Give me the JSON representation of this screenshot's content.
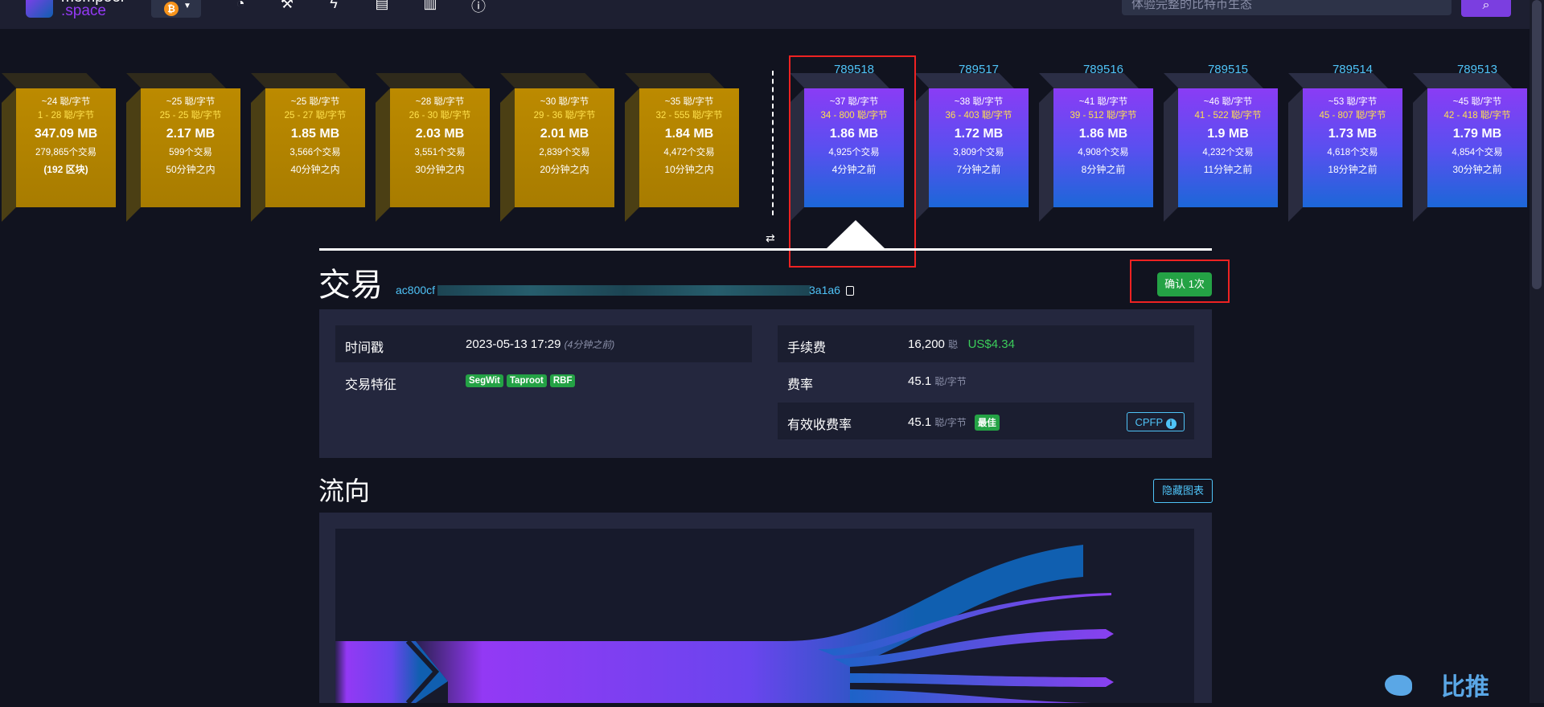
{
  "header": {
    "logo_line1": "mempool",
    "logo_line2": ".space",
    "search_placeholder": "体验完整的比特币生态",
    "search_icon": "search-icon",
    "network_icon": "bitcoin-icon",
    "nav_icons": [
      "dashboard-icon",
      "mining-icon",
      "lightning-icon",
      "blocks-icon",
      "docs-icon",
      "about-icon"
    ]
  },
  "pending_blocks": [
    {
      "fee": "~24 聪/字节",
      "range": "1 - 28 聪/字节",
      "size": "347.09 MB",
      "txs": "279,865个交易",
      "time": "(192 区块)"
    },
    {
      "fee": "~25 聪/字节",
      "range": "25 - 25 聪/字节",
      "size": "2.17 MB",
      "txs": "599个交易",
      "time": "50分钟之内"
    },
    {
      "fee": "~25 聪/字节",
      "range": "25 - 27 聪/字节",
      "size": "1.85 MB",
      "txs": "3,566个交易",
      "time": "40分钟之内"
    },
    {
      "fee": "~28 聪/字节",
      "range": "26 - 30 聪/字节",
      "size": "2.03 MB",
      "txs": "3,551个交易",
      "time": "30分钟之内"
    },
    {
      "fee": "~30 聪/字节",
      "range": "29 - 36 聪/字节",
      "size": "2.01 MB",
      "txs": "2,839个交易",
      "time": "20分钟之内"
    },
    {
      "fee": "~35 聪/字节",
      "range": "32 - 555 聪/字节",
      "size": "1.84 MB",
      "txs": "4,472个交易",
      "time": "10分钟之内"
    }
  ],
  "mined_blocks": [
    {
      "height": "789518",
      "fee": "~37 聪/字节",
      "range": "34 - 800 聪/字节",
      "size": "1.86 MB",
      "txs": "4,925个交易",
      "time": "4分钟之前"
    },
    {
      "height": "789517",
      "fee": "~38 聪/字节",
      "range": "36 - 403 聪/字节",
      "size": "1.72 MB",
      "txs": "3,809个交易",
      "time": "7分钟之前"
    },
    {
      "height": "789516",
      "fee": "~41 聪/字节",
      "range": "39 - 512 聪/字节",
      "size": "1.86 MB",
      "txs": "4,908个交易",
      "time": "8分钟之前"
    },
    {
      "height": "789515",
      "fee": "~46 聪/字节",
      "range": "41 - 522 聪/字节",
      "size": "1.9 MB",
      "txs": "4,232个交易",
      "time": "11分钟之前"
    },
    {
      "height": "789514",
      "fee": "~53 聪/字节",
      "range": "45 - 807 聪/字节",
      "size": "1.73 MB",
      "txs": "4,618个交易",
      "time": "18分钟之前"
    },
    {
      "height": "789513",
      "fee": "~45 聪/字节",
      "range": "42 - 418 聪/字节",
      "size": "1.79 MB",
      "txs": "4,854个交易",
      "time": "30分钟之前"
    }
  ],
  "transaction": {
    "title": "交易",
    "hash_start": "ac800cf",
    "hash_end": "3a1a6",
    "confirm_label": "确认 1次",
    "timestamp_label": "时间戳",
    "timestamp_value": "2023-05-13 17:29",
    "timestamp_ago": "(4分钟之前)",
    "features_label": "交易特征",
    "features": [
      "SegWit",
      "Taproot",
      "RBF"
    ],
    "fee_label": "手续费",
    "fee_value": "16,200",
    "fee_unit": "聪",
    "fee_usd": "US$4.34",
    "rate_label": "费率",
    "rate_value": "45.1",
    "rate_unit": "聪/字节",
    "eff_rate_label": "有效收费率",
    "eff_rate_value": "45.1",
    "eff_rate_unit": "聪/字节",
    "eff_rate_badge": "最佳",
    "cpfp_label": "CPFP"
  },
  "flow": {
    "title": "流向",
    "hide_button": "隐藏图表"
  },
  "watermark": {
    "text": "比推"
  },
  "colors": {
    "background": "#11131f",
    "panel": "#24273e",
    "accent_blue": "#4fc3f7",
    "green": "#24a245",
    "purple": "#9339f4",
    "pending_gold": "#bc8a00",
    "highlight_red": "#e22222"
  }
}
